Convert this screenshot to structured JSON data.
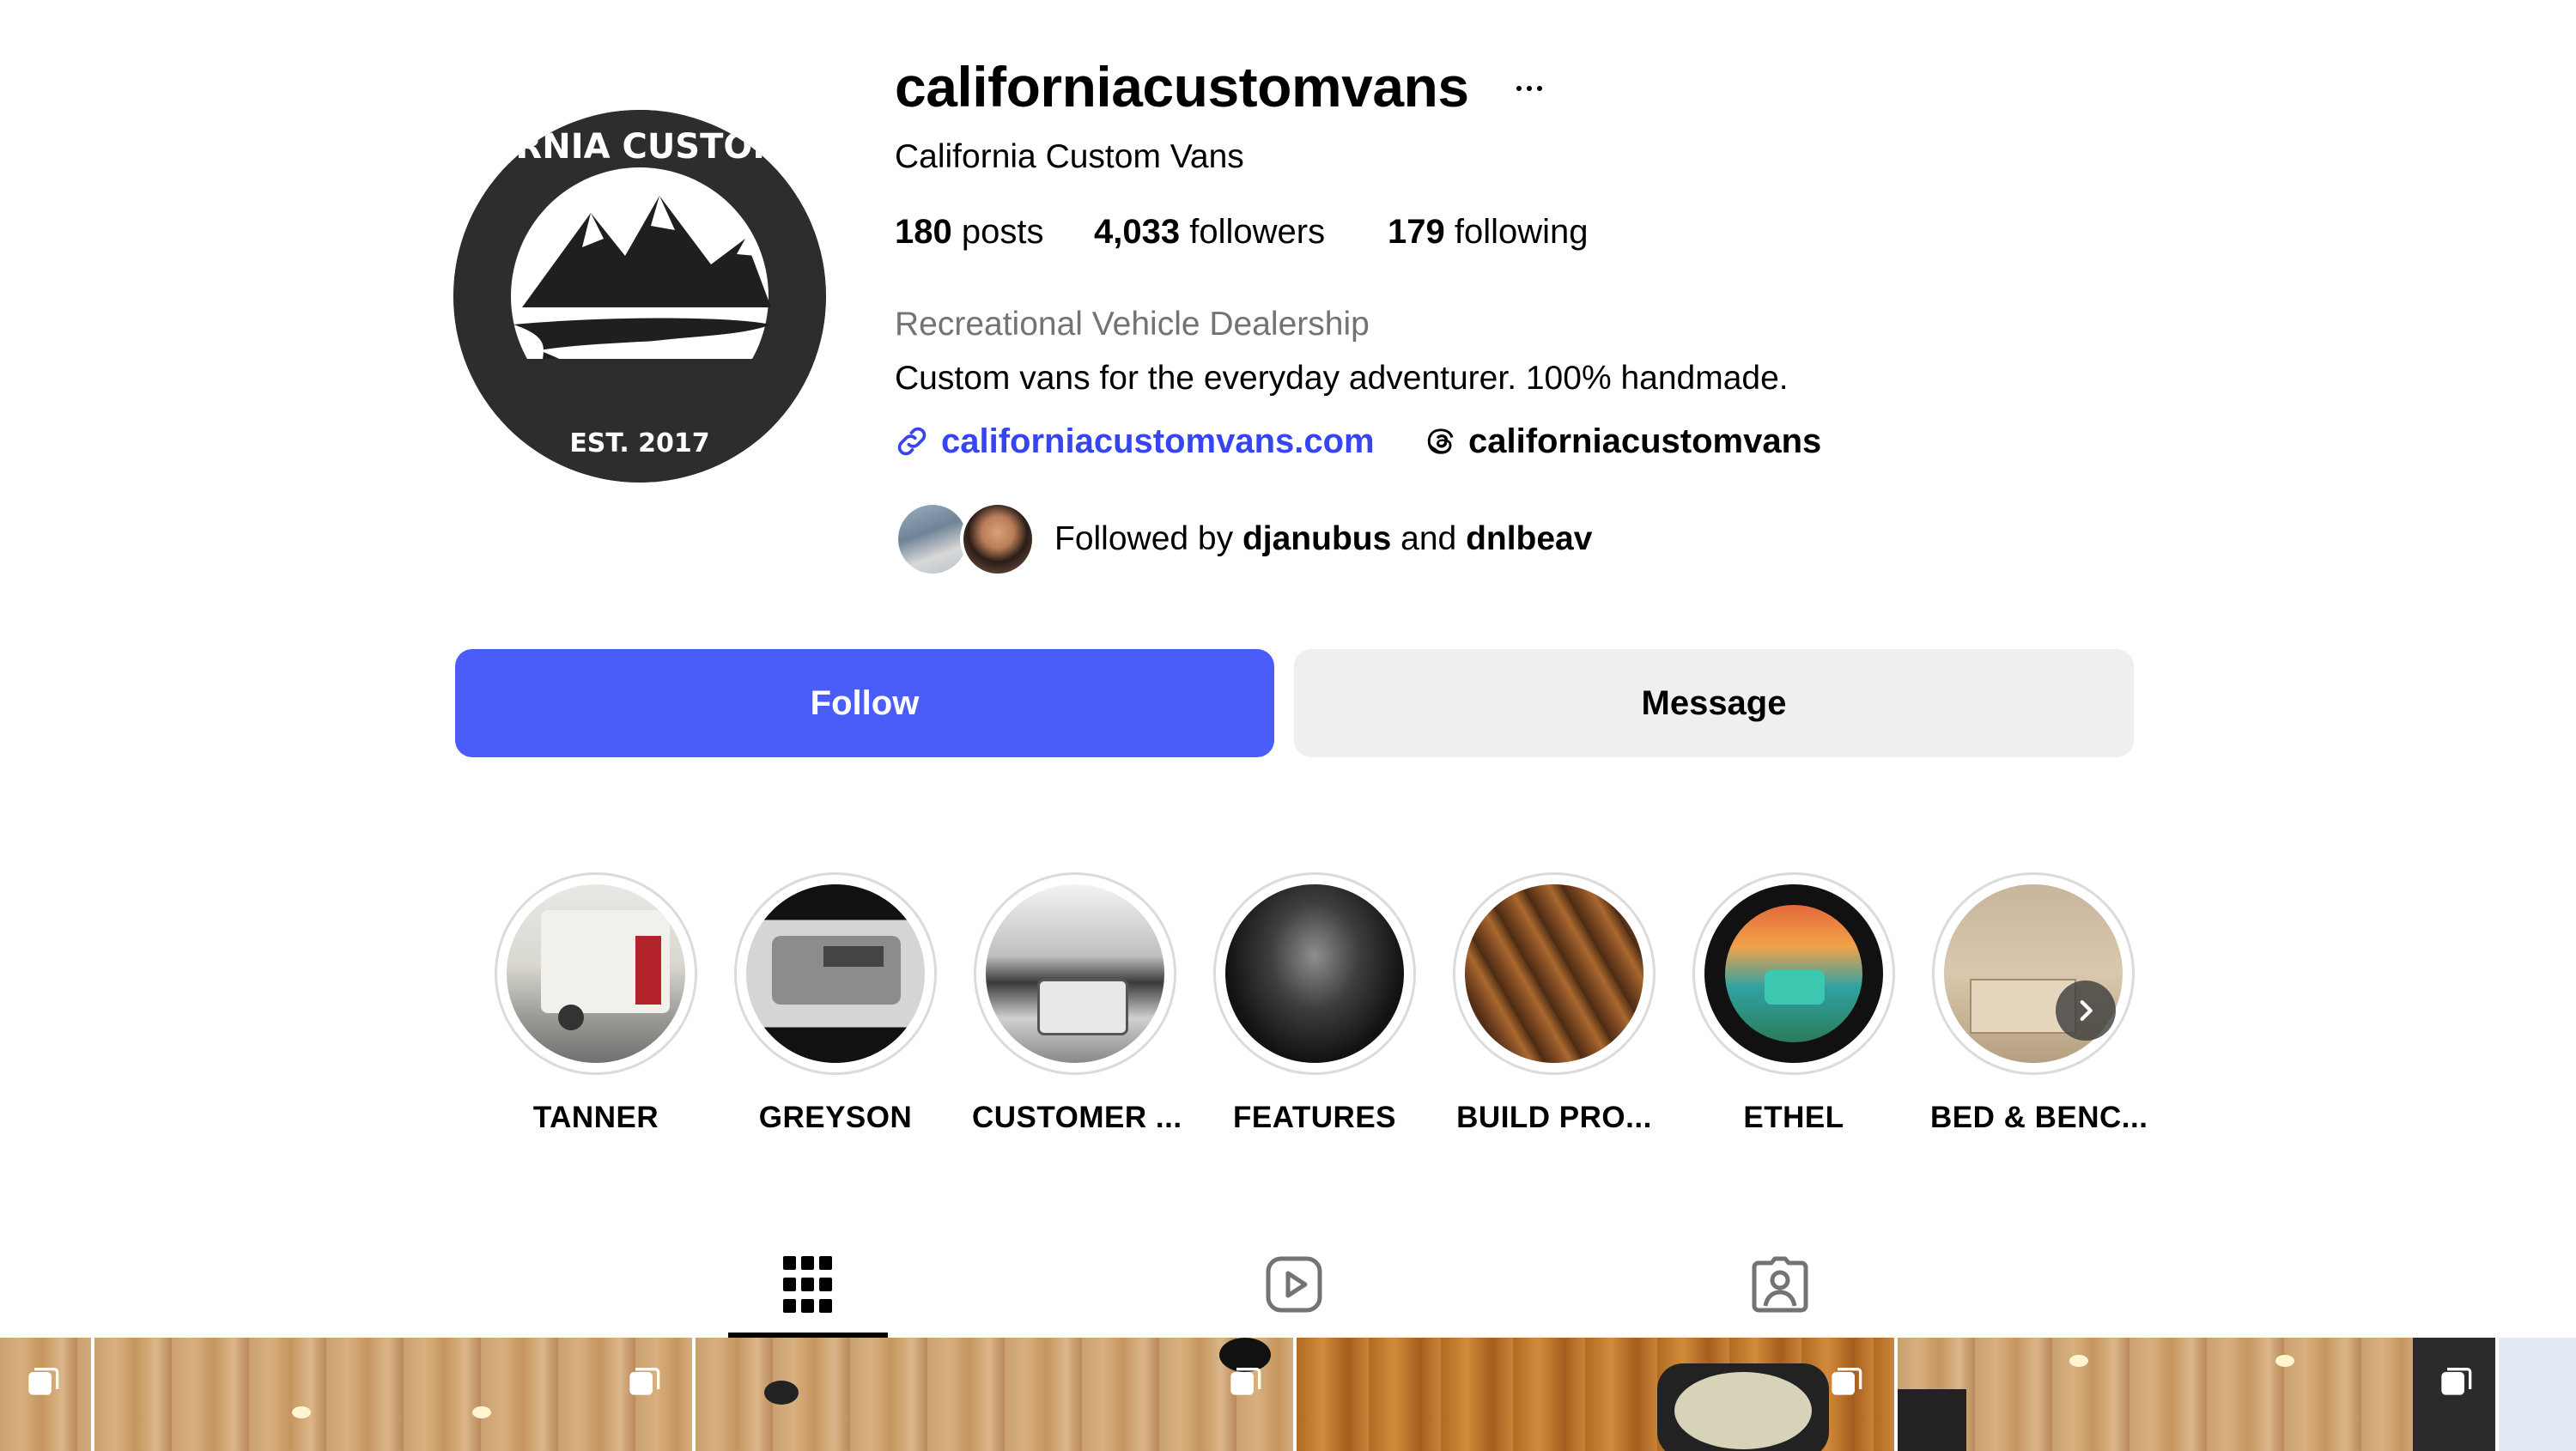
{
  "profile": {
    "username": "californiacustomvans",
    "full_name": "California Custom Vans",
    "category": "Recreational Vehicle Dealership",
    "bio": "Custom vans for the everyday adventurer. 100% handmade.",
    "link": "californiacustomvans.com",
    "threads_handle": "californiacustomvans",
    "logo_text": "CALIFORNIA CUSTOM VANS",
    "logo_est": "EST. 2017"
  },
  "stats": {
    "posts_count": "180",
    "posts_label": "posts",
    "followers_count": "4,033",
    "followers_label": "followers",
    "following_count": "179",
    "following_label": "following"
  },
  "followed_by": {
    "prefix": "Followed by",
    "user1": "djanubus",
    "connector": "and",
    "user2": "dnlbeav"
  },
  "actions": {
    "follow_label": "Follow",
    "message_label": "Message"
  },
  "highlights": [
    {
      "label": "TANNER"
    },
    {
      "label": "GREYSON"
    },
    {
      "label": "CUSTOMER ..."
    },
    {
      "label": "FEATURES"
    },
    {
      "label": "BUILD PRO..."
    },
    {
      "label": "ETHEL"
    },
    {
      "label": "BED & BENC..."
    }
  ],
  "tabs": [
    {
      "name": "posts",
      "icon": "grid-icon",
      "active": true
    },
    {
      "name": "reels",
      "icon": "reels-icon",
      "active": false
    },
    {
      "name": "tagged",
      "icon": "tagged-icon",
      "active": false
    }
  ],
  "colors": {
    "follow_button": "#4a5df9",
    "link": "#3645f0",
    "message_button": "#efefef",
    "category_text": "#737373"
  }
}
